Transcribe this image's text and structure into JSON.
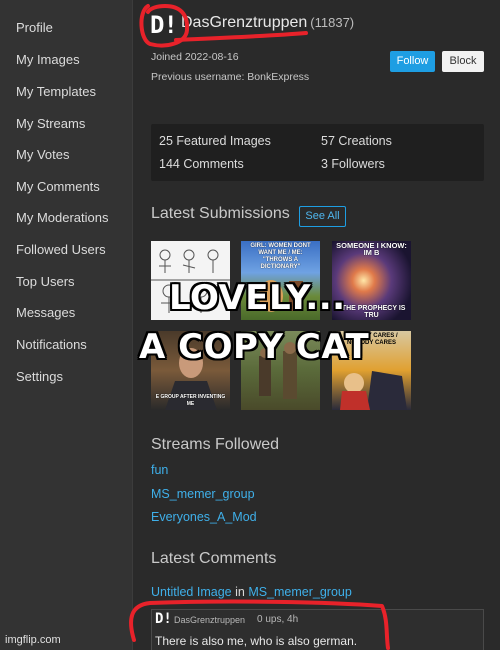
{
  "sidebar": {
    "items": [
      {
        "label": "Profile"
      },
      {
        "label": "My Images"
      },
      {
        "label": "My Templates"
      },
      {
        "label": "My Streams"
      },
      {
        "label": "My Votes"
      },
      {
        "label": "My Comments"
      },
      {
        "label": "My Moderations"
      },
      {
        "label": "Followed Users"
      },
      {
        "label": "Top Users"
      },
      {
        "label": "Messages"
      },
      {
        "label": "Notifications"
      },
      {
        "label": "Settings"
      }
    ]
  },
  "profile": {
    "logo_text": "D!",
    "username": "DasGrenztruppen",
    "score": "(11837)",
    "joined": "Joined 2022-08-16",
    "previous_username": "Previous username: BonkExpress",
    "follow_label": "Follow",
    "block_label": "Block"
  },
  "stats": {
    "featured": "25 Featured Images",
    "creations": "57 Creations",
    "comments": "144 Comments",
    "followers": "3 Followers"
  },
  "submissions": {
    "title": "Latest Submissions",
    "see_all": "See All",
    "thumbs": [
      {
        "caption_top": "",
        "caption_bottom": ""
      },
      {
        "caption_top": "GIRL: WOMEN DONT WANT ME / ME: \"THROWS A DICTIONARY\"",
        "caption_bottom": ""
      },
      {
        "caption_top": "SOMEONE I KNOW: IM B",
        "caption_bottom": ": THE PROPHECY IS TRU"
      },
      {
        "caption_top": "",
        "caption_bottom": "E GROUP AFTER INVENTING ME"
      },
      {
        "caption_top": "",
        "caption_bottom": ""
      },
      {
        "caption_top": "NOBODY CARES / NOBODY CARES",
        "caption_bottom": ""
      }
    ]
  },
  "overlay": {
    "line1": "LOVELY...",
    "line2": "A COPY CAT"
  },
  "streams": {
    "title": "Streams Followed",
    "items": [
      {
        "label": "fun"
      },
      {
        "label": "MS_memer_group"
      },
      {
        "label": "Everyones_A_Mod"
      }
    ]
  },
  "comments": {
    "title": "Latest Comments",
    "image_link": "Untitled Image",
    "in_word": "in",
    "stream_link": "MS_memer_group",
    "author_logo": "D!",
    "author": "DasGrenztruppen",
    "meta": "0 ups, 4h",
    "text": "There is also me, who is also german."
  },
  "watermark": "imgflip.com",
  "colors": {
    "accent": "#1e9ee3",
    "link": "#3fb0ea",
    "annotation": "#e8222a"
  }
}
